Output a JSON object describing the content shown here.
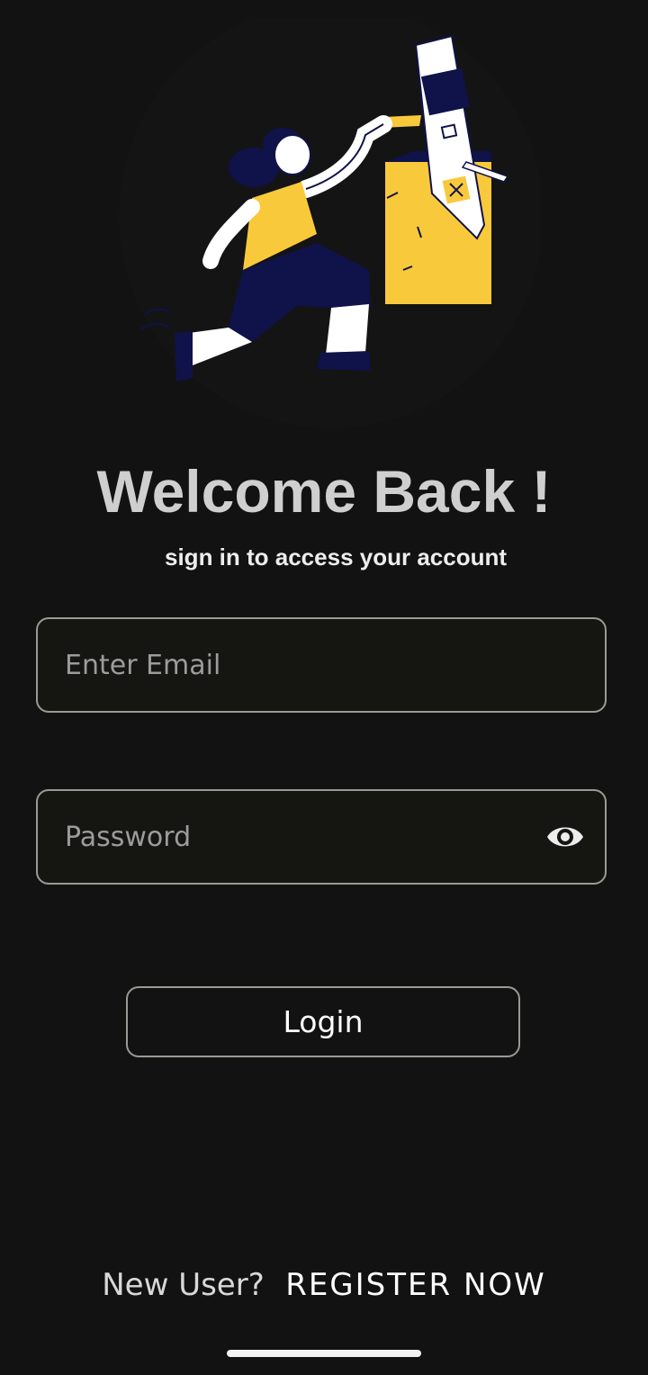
{
  "header": {
    "title": "Welcome Back !",
    "subtitle": "sign in to access your account"
  },
  "form": {
    "email_placeholder": "Enter Email",
    "email_value": "",
    "password_placeholder": "Password",
    "password_value": "",
    "login_label": "Login"
  },
  "footer": {
    "prompt": "New User?",
    "register_label": "REGISTER NOW"
  },
  "icons": {
    "hero": "person-inserting-card-illustration",
    "password_toggle": "eye-icon"
  },
  "colors": {
    "background": "#121212",
    "accent_yellow": "#f9c93c",
    "navy": "#10124a",
    "border": "#9a9a94"
  }
}
